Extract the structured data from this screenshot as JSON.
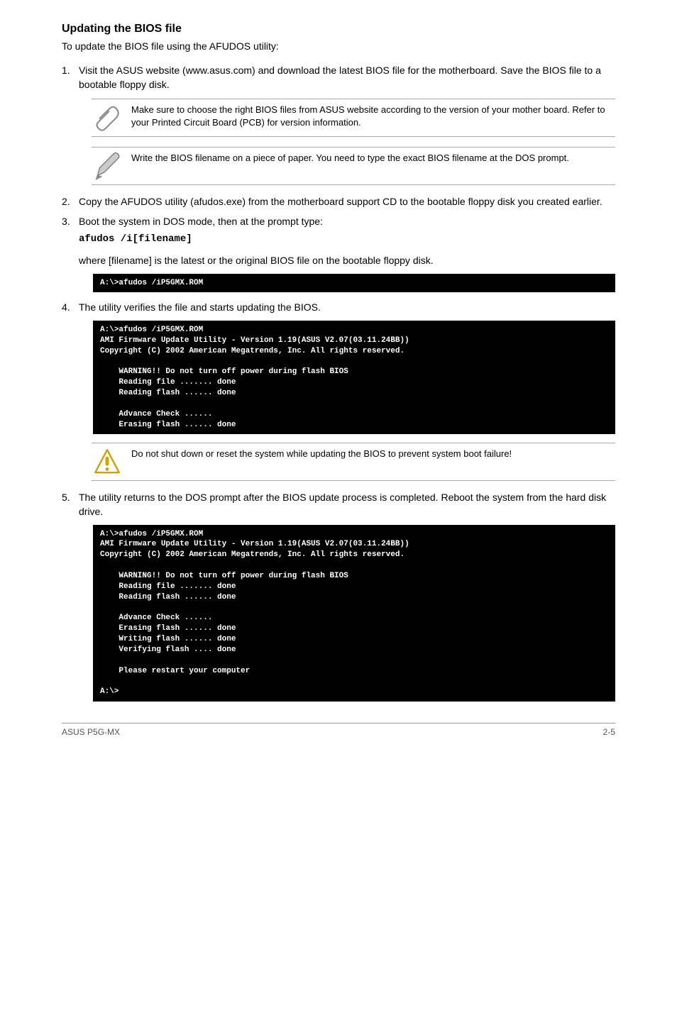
{
  "heading": "Updating the BIOS file",
  "intro": "To update the BIOS file using the AFUDOS utility:",
  "steps": {
    "s1": {
      "num": "1.",
      "text": "Visit the ASUS website (www.asus.com) and download the latest BIOS file for the motherboard. Save the BIOS file to a bootable floppy disk."
    },
    "s2": {
      "num": "2.",
      "text": "Copy the AFUDOS utility (afudos.exe) from the motherboard support CD to the bootable floppy disk you created earlier."
    },
    "s3": {
      "num": "3.",
      "text": "Boot the system in DOS mode, then at the prompt type:",
      "code": "afudos /i[filename]",
      "after": "where [filename] is the latest or the original BIOS file on the bootable floppy disk."
    },
    "s4": {
      "num": "4.",
      "text": "The utility verifies the file and starts updating the BIOS."
    },
    "s5": {
      "num": "5.",
      "text": "The utility returns to the DOS prompt after the BIOS update process is completed. Reboot the system from the hard disk drive."
    }
  },
  "notes": {
    "n1": "Make sure to choose the right BIOS files from ASUS website according to the version of your mother board. Refer to your Printed Circuit Board (PCB) for version information.",
    "n2": "Write the BIOS filename on a piece of paper. You need to type the exact BIOS filename at the DOS prompt.",
    "n3": "Do not shut down or reset the system while updating the BIOS to prevent system boot failure!"
  },
  "terminals": {
    "t1": "A:\\>afudos /iP5GMX.ROM",
    "t2": "A:\\>afudos /iP5GMX.ROM\nAMI Firmware Update Utility - Version 1.19(ASUS V2.07(03.11.24BB))\nCopyright (C) 2002 American Megatrends, Inc. All rights reserved.\n\n    WARNING!! Do not turn off power during flash BIOS\n    Reading file ....... done\n    Reading flash ...... done\n\n    Advance Check ......\n    Erasing flash ...... done",
    "t3": "A:\\>afudos /iP5GMX.ROM\nAMI Firmware Update Utility - Version 1.19(ASUS V2.07(03.11.24BB))\nCopyright (C) 2002 American Megatrends, Inc. All rights reserved.\n\n    WARNING!! Do not turn off power during flash BIOS\n    Reading file ....... done\n    Reading flash ...... done\n\n    Advance Check ......\n    Erasing flash ...... done\n    Writing flash ...... done\n    Verifying flash .... done\n\n    Please restart your computer\n\nA:\\>"
  },
  "footer": {
    "left": "ASUS P5G-MX",
    "right": "2-5"
  }
}
